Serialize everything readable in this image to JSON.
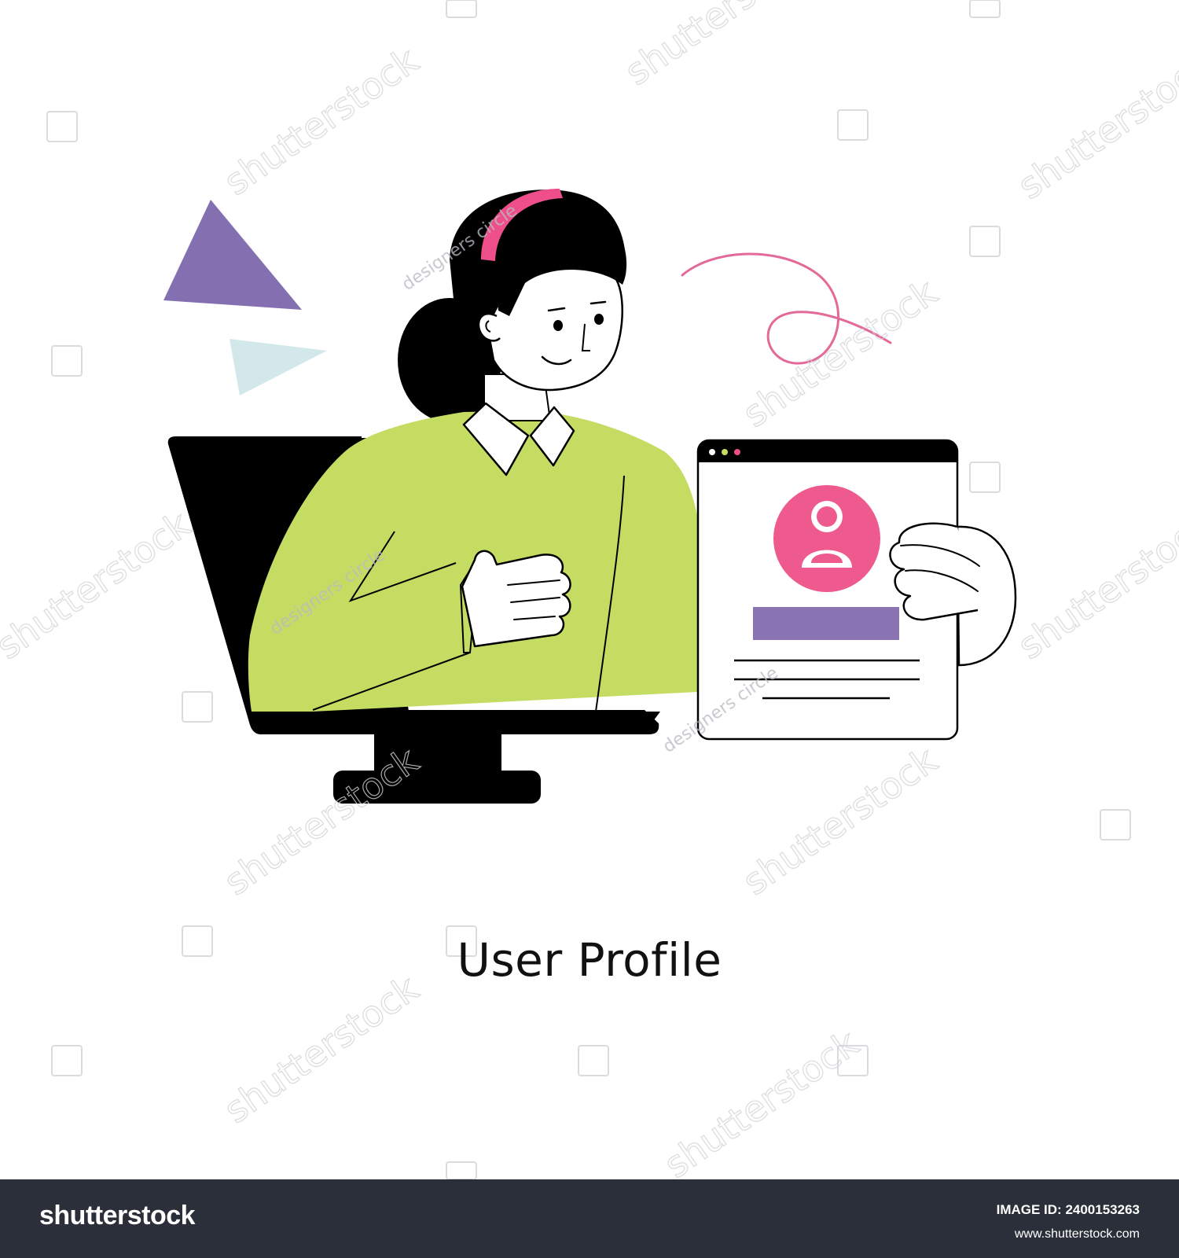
{
  "illustration": {
    "caption": "User Profile",
    "watermark_text": "shutterstock",
    "artist_watermark_text": "designers circle",
    "colors": {
      "sweater": "#c5dc62",
      "hair": "#000000",
      "headband": "#ee4f8a",
      "avatar_circle": "#ee5a8e",
      "name_bar": "#8a73b3",
      "triangle_purple": "#8470b0",
      "triangle_light": "#d3e8ea",
      "squiggle": "#e36a98",
      "monitor": "#000000"
    }
  },
  "footer": {
    "brand": "shutterstock",
    "image_id_label": "IMAGE ID: 2400153263",
    "url": "www.shutterstock.com"
  }
}
